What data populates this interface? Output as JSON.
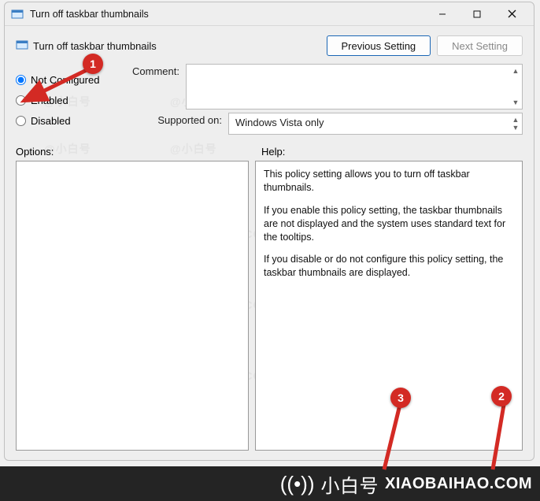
{
  "window": {
    "title": "Turn off taskbar thumbnails",
    "subtitle": "Turn off taskbar thumbnails"
  },
  "nav": {
    "previous": "Previous Setting",
    "next": "Next Setting"
  },
  "radios": {
    "not_configured": "Not Configured",
    "enabled": "Enabled",
    "disabled": "Disabled"
  },
  "labels": {
    "comment": "Comment:",
    "supported_on": "Supported on:",
    "options": "Options:",
    "help": "Help:"
  },
  "supported_text": "Windows Vista only",
  "help": {
    "p1": "This policy setting allows you to turn off taskbar thumbnails.",
    "p2": "If you enable this policy setting, the taskbar thumbnails are not displayed and the system uses standard text for the tooltips.",
    "p3": "If you disable or do not configure this policy setting, the taskbar thumbnails are displayed."
  },
  "annotations": {
    "a1": "1",
    "a2": "2",
    "a3": "3"
  },
  "watermark": {
    "brand": "小白号",
    "url": "XIAOBAIHAO.COM"
  }
}
